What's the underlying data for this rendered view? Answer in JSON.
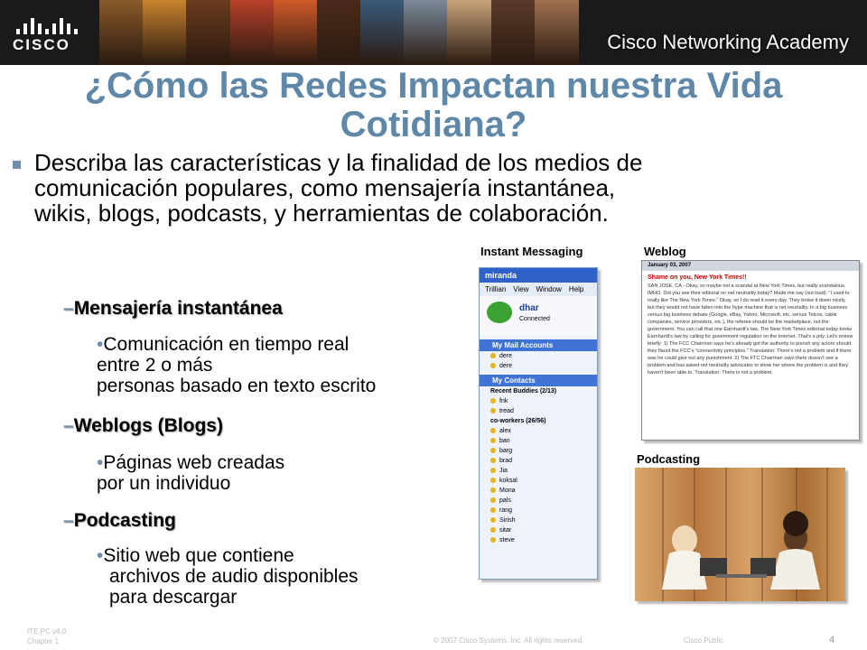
{
  "header": {
    "logo_text": "CISCO",
    "academy": "Cisco Networking Academy",
    "strip_colors": [
      "#8a5a2a",
      "#c9832e",
      "#6b3b1e",
      "#b8402a",
      "#d05a2a",
      "#4a2a1a",
      "#3a5a7a",
      "#7a8a9a",
      "#c7a37a",
      "#5a3a2a",
      "#a07050"
    ]
  },
  "slide": {
    "title": "¿Cómo las Redes Impactan nuestra Vida   Cotidiana?",
    "main_bullet": "Describa las características y la finalidad de los medios de comunicación populares, como mensajería instantánea, wikis, blogs, podcasts, y herramientas de colaboración.",
    "sections": [
      {
        "dash": "–",
        "heading": "Mensajería instantánea",
        "dot": "•",
        "line1": "Comunicación en tiempo real",
        "line2": "entre 2 o más",
        "line3": "personas basado en texto escrito"
      },
      {
        "dash": "–",
        "heading": "Weblogs (Blogs)",
        "dot": "•",
        "line1": "Páginas web creadas",
        "line2": "por un individuo"
      },
      {
        "dash": "–",
        "heading": "Podcasting",
        "dot": "•",
        "line1": "Sitio web que contiene",
        "line2": "archivos de audio disponibles",
        "line3": "para descargar"
      }
    ]
  },
  "captions": {
    "im": "Instant Messaging",
    "weblog": "Weblog",
    "podcasting": "Podcasting"
  },
  "im_window": {
    "title": "miranda",
    "menu": [
      "Trillian",
      "View",
      "Window",
      "Help"
    ],
    "user": "dhar",
    "status": "Connected",
    "mail_section": "My Mail Accounts",
    "mail_items": [
      "dere",
      "dere"
    ],
    "contacts_section": "My Contacts",
    "group1": "Recent Buddies (2/13)",
    "group1_items": [
      "fnk",
      "tread"
    ],
    "group2": "co-workers (26/56)",
    "group2_items": [
      "alex",
      "ban",
      "barg",
      "brad",
      "Jia",
      "koksal",
      "Mona",
      "pals",
      "rang",
      "Sirish",
      "sitar",
      "steve"
    ]
  },
  "weblog": {
    "date": "January 03, 2007",
    "headline": "Shame on you, New York Times!!",
    "body": "SAN JOSE, CA - Okay, so maybe not a scandal at New York Times, but really scandalous. IMHO. Did you see their editorial on net neutrality today? Made me say (out loud): \"I used to really like The New York Times.\" Okay, so I do read it every day. They broke it down nicely, but they would not have fallen into the hype machine that is net neutrality. In a big business versus big business debate (Google, eBay, Yahoo, Microsoft, etc. versus Telcos, cable companies, service providers, etc.), the referee should be the marketplace, not the government. You can call that one Earnhardt's law. The New York Times editorial today broke Earnhardt's law by calling for government regulation on the Internet. That's a pity. Let's review briefly: 1) The FCC Chairman says he's already got the authority to punish any actors should they flaunt the FCC's \"connectivity principles.\" Translation: There's not a problem and if there was he could give out any punishment. 2) The FTC Chairman says there doesn't see a problem and has asked not neutrality advocates to show her where the problem is and they haven't been able to. Translation: There is not a problem."
  },
  "footer": {
    "left_line1": "ITE PC v4.0",
    "left_line2": "Chapter 1",
    "copyright": "© 2007 Cisco Systems, Inc. All rights reserved.",
    "public": "Cisco Public",
    "page": "4"
  }
}
